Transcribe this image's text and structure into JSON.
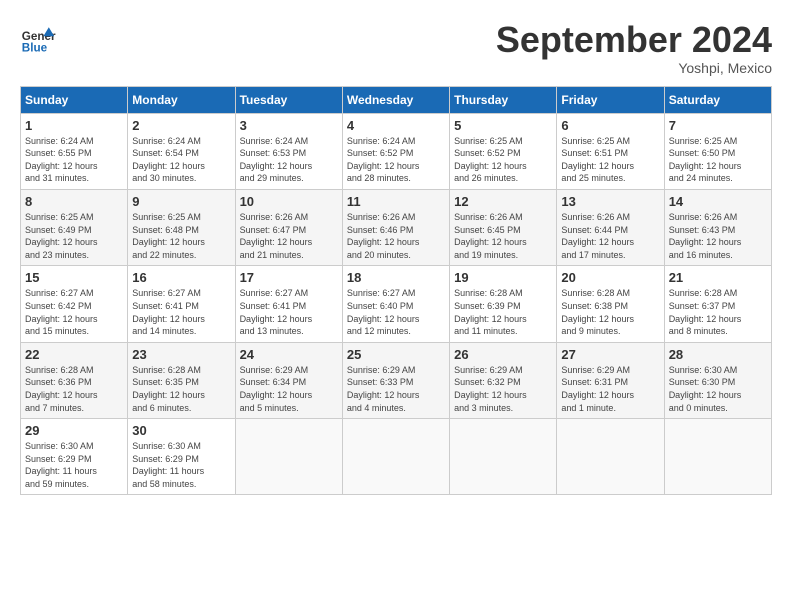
{
  "header": {
    "logo_line1": "General",
    "logo_line2": "Blue",
    "month_title": "September 2024",
    "location": "Yoshpi, Mexico"
  },
  "weekdays": [
    "Sunday",
    "Monday",
    "Tuesday",
    "Wednesday",
    "Thursday",
    "Friday",
    "Saturday"
  ],
  "weeks": [
    [
      {
        "day": "1",
        "info": "Sunrise: 6:24 AM\nSunset: 6:55 PM\nDaylight: 12 hours\nand 31 minutes."
      },
      {
        "day": "2",
        "info": "Sunrise: 6:24 AM\nSunset: 6:54 PM\nDaylight: 12 hours\nand 30 minutes."
      },
      {
        "day": "3",
        "info": "Sunrise: 6:24 AM\nSunset: 6:53 PM\nDaylight: 12 hours\nand 29 minutes."
      },
      {
        "day": "4",
        "info": "Sunrise: 6:24 AM\nSunset: 6:52 PM\nDaylight: 12 hours\nand 28 minutes."
      },
      {
        "day": "5",
        "info": "Sunrise: 6:25 AM\nSunset: 6:52 PM\nDaylight: 12 hours\nand 26 minutes."
      },
      {
        "day": "6",
        "info": "Sunrise: 6:25 AM\nSunset: 6:51 PM\nDaylight: 12 hours\nand 25 minutes."
      },
      {
        "day": "7",
        "info": "Sunrise: 6:25 AM\nSunset: 6:50 PM\nDaylight: 12 hours\nand 24 minutes."
      }
    ],
    [
      {
        "day": "8",
        "info": "Sunrise: 6:25 AM\nSunset: 6:49 PM\nDaylight: 12 hours\nand 23 minutes."
      },
      {
        "day": "9",
        "info": "Sunrise: 6:25 AM\nSunset: 6:48 PM\nDaylight: 12 hours\nand 22 minutes."
      },
      {
        "day": "10",
        "info": "Sunrise: 6:26 AM\nSunset: 6:47 PM\nDaylight: 12 hours\nand 21 minutes."
      },
      {
        "day": "11",
        "info": "Sunrise: 6:26 AM\nSunset: 6:46 PM\nDaylight: 12 hours\nand 20 minutes."
      },
      {
        "day": "12",
        "info": "Sunrise: 6:26 AM\nSunset: 6:45 PM\nDaylight: 12 hours\nand 19 minutes."
      },
      {
        "day": "13",
        "info": "Sunrise: 6:26 AM\nSunset: 6:44 PM\nDaylight: 12 hours\nand 17 minutes."
      },
      {
        "day": "14",
        "info": "Sunrise: 6:26 AM\nSunset: 6:43 PM\nDaylight: 12 hours\nand 16 minutes."
      }
    ],
    [
      {
        "day": "15",
        "info": "Sunrise: 6:27 AM\nSunset: 6:42 PM\nDaylight: 12 hours\nand 15 minutes."
      },
      {
        "day": "16",
        "info": "Sunrise: 6:27 AM\nSunset: 6:41 PM\nDaylight: 12 hours\nand 14 minutes."
      },
      {
        "day": "17",
        "info": "Sunrise: 6:27 AM\nSunset: 6:41 PM\nDaylight: 12 hours\nand 13 minutes."
      },
      {
        "day": "18",
        "info": "Sunrise: 6:27 AM\nSunset: 6:40 PM\nDaylight: 12 hours\nand 12 minutes."
      },
      {
        "day": "19",
        "info": "Sunrise: 6:28 AM\nSunset: 6:39 PM\nDaylight: 12 hours\nand 11 minutes."
      },
      {
        "day": "20",
        "info": "Sunrise: 6:28 AM\nSunset: 6:38 PM\nDaylight: 12 hours\nand 9 minutes."
      },
      {
        "day": "21",
        "info": "Sunrise: 6:28 AM\nSunset: 6:37 PM\nDaylight: 12 hours\nand 8 minutes."
      }
    ],
    [
      {
        "day": "22",
        "info": "Sunrise: 6:28 AM\nSunset: 6:36 PM\nDaylight: 12 hours\nand 7 minutes."
      },
      {
        "day": "23",
        "info": "Sunrise: 6:28 AM\nSunset: 6:35 PM\nDaylight: 12 hours\nand 6 minutes."
      },
      {
        "day": "24",
        "info": "Sunrise: 6:29 AM\nSunset: 6:34 PM\nDaylight: 12 hours\nand 5 minutes."
      },
      {
        "day": "25",
        "info": "Sunrise: 6:29 AM\nSunset: 6:33 PM\nDaylight: 12 hours\nand 4 minutes."
      },
      {
        "day": "26",
        "info": "Sunrise: 6:29 AM\nSunset: 6:32 PM\nDaylight: 12 hours\nand 3 minutes."
      },
      {
        "day": "27",
        "info": "Sunrise: 6:29 AM\nSunset: 6:31 PM\nDaylight: 12 hours\nand 1 minute."
      },
      {
        "day": "28",
        "info": "Sunrise: 6:30 AM\nSunset: 6:30 PM\nDaylight: 12 hours\nand 0 minutes."
      }
    ],
    [
      {
        "day": "29",
        "info": "Sunrise: 6:30 AM\nSunset: 6:29 PM\nDaylight: 11 hours\nand 59 minutes."
      },
      {
        "day": "30",
        "info": "Sunrise: 6:30 AM\nSunset: 6:29 PM\nDaylight: 11 hours\nand 58 minutes."
      },
      {
        "day": "",
        "info": ""
      },
      {
        "day": "",
        "info": ""
      },
      {
        "day": "",
        "info": ""
      },
      {
        "day": "",
        "info": ""
      },
      {
        "day": "",
        "info": ""
      }
    ]
  ]
}
